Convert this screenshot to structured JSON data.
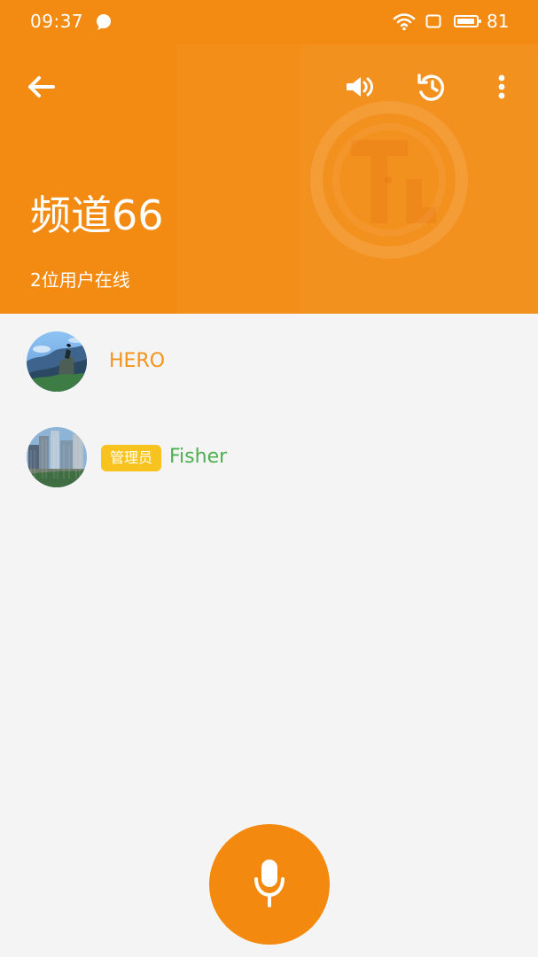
{
  "status_bar": {
    "time": "09:37",
    "battery": "81",
    "icons": [
      "chat-bubble-icon",
      "wifi-icon",
      "screen-icon",
      "battery-icon"
    ]
  },
  "app_bar": {
    "back_icon": "back-arrow-icon",
    "volume_icon": "volume-icon",
    "history_icon": "history-icon",
    "more_icon": "more-icon"
  },
  "channel": {
    "title": "频道66",
    "subtitle": "2位用户在线"
  },
  "users": [
    {
      "name": "HERO",
      "avatar_icon": "mountain-avatar-icon",
      "name_color": "#f39419"
    },
    {
      "name": "Fisher",
      "badge": "管理员",
      "avatar_icon": "city-avatar-icon",
      "name_color": "#4caf50",
      "badge_color": "#f8c31f"
    }
  ],
  "footer": {
    "mic_icon": "mic-icon",
    "accent_color": "#f38a0f"
  },
  "colors": {
    "header": "#f38b12",
    "background": "#f4f4f4"
  }
}
